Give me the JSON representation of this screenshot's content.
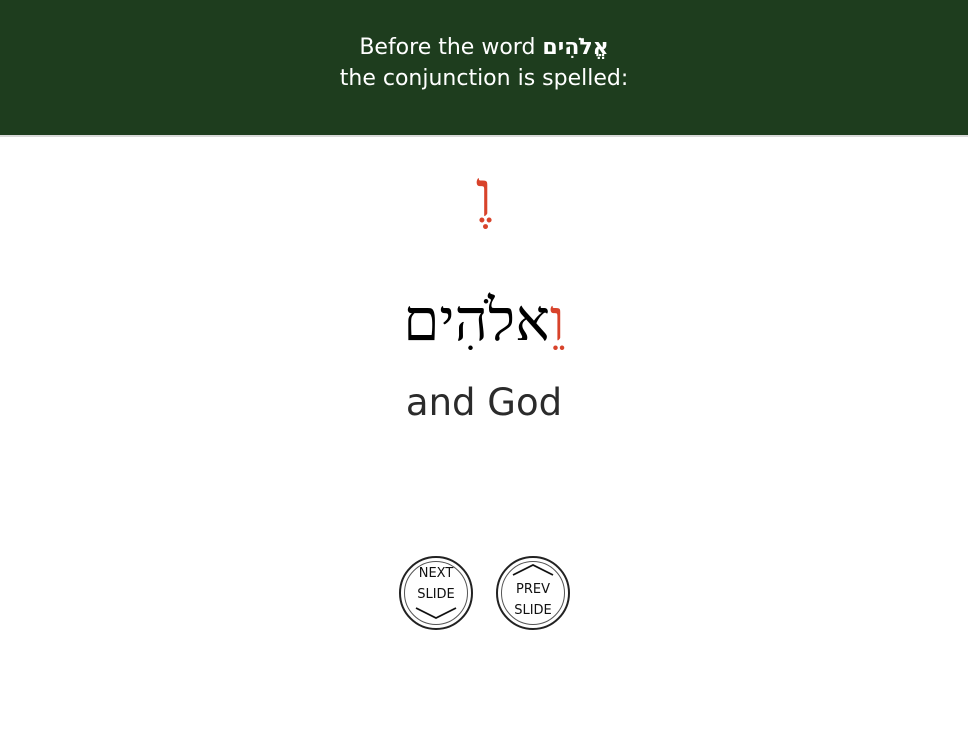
{
  "header": {
    "line1_text": "Before the word",
    "line1_hebrew": "אֱלֹהִים",
    "line2_text": "the conjunction is spelled:"
  },
  "prefix": {
    "text": "וֶ",
    "color": "#d8432b"
  },
  "word": {
    "prefix": "וֵ",
    "prefix_color": "#d8432b",
    "rest": "אלֹהִים",
    "rest_color": "#000000"
  },
  "translation": "and God",
  "nav": {
    "next": {
      "line1": "NEXT",
      "line2": "SLIDE",
      "icon": "chevron-down-icon"
    },
    "prev": {
      "line1": "PREV",
      "line2": "SLIDE",
      "icon": "chevron-up-icon"
    }
  },
  "colors": {
    "header_bg": "#1e3d1e",
    "header_text": "#ffffff",
    "accent_red": "#d8432b",
    "body_text": "#2b2b2b"
  }
}
